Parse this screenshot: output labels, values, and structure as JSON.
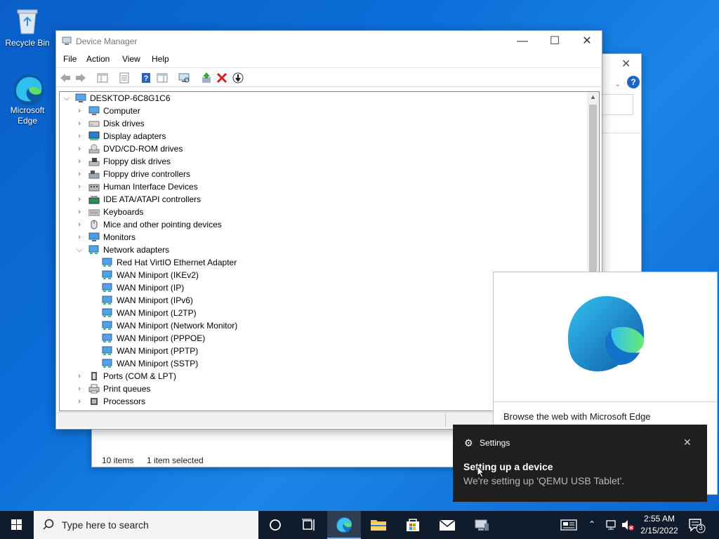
{
  "desktop": {
    "icons": [
      {
        "label": "Recycle Bin"
      },
      {
        "label": "Microsoft Edge"
      }
    ]
  },
  "background_window": {
    "status_items": "10 items",
    "status_selected": "1 item selected"
  },
  "device_manager": {
    "title": "Device Manager",
    "menu": [
      "File",
      "Action",
      "View",
      "Help"
    ],
    "root": "DESKTOP-6C8G1C6",
    "categories": [
      {
        "label": "Computer",
        "icon": "computer-icon"
      },
      {
        "label": "Disk drives",
        "icon": "disk-drive-icon"
      },
      {
        "label": "Display adapters",
        "icon": "display-adapter-icon"
      },
      {
        "label": "DVD/CD-ROM drives",
        "icon": "dvd-drive-icon"
      },
      {
        "label": "Floppy disk drives",
        "icon": "floppy-drive-icon"
      },
      {
        "label": "Floppy drive controllers",
        "icon": "floppy-controller-icon"
      },
      {
        "label": "Human Interface Devices",
        "icon": "hid-icon"
      },
      {
        "label": "IDE ATA/ATAPI controllers",
        "icon": "ide-controller-icon"
      },
      {
        "label": "Keyboards",
        "icon": "keyboard-icon"
      },
      {
        "label": "Mice and other pointing devices",
        "icon": "mouse-icon"
      },
      {
        "label": "Monitors",
        "icon": "monitor-icon"
      },
      {
        "label": "Network adapters",
        "icon": "network-adapter-icon",
        "expanded": true
      }
    ],
    "network_children": [
      "Red Hat VirtIO Ethernet Adapter",
      "WAN Miniport (IKEv2)",
      "WAN Miniport (IP)",
      "WAN Miniport (IPv6)",
      "WAN Miniport (L2TP)",
      "WAN Miniport (Network Monitor)",
      "WAN Miniport (PPPOE)",
      "WAN Miniport (PPTP)",
      "WAN Miniport (SSTP)"
    ],
    "more_categories": [
      {
        "label": "Ports (COM & LPT)",
        "icon": "port-icon"
      },
      {
        "label": "Print queues",
        "icon": "printer-icon"
      },
      {
        "label": "Processors",
        "icon": "processor-icon"
      }
    ]
  },
  "edge_promo": {
    "text": "Browse the web with Microsoft Edge"
  },
  "toast": {
    "app": "Settings",
    "headline": "Setting up a device",
    "body": "We're setting up 'QEMU USB Tablet'."
  },
  "taskbar": {
    "search_placeholder": "Type here to search",
    "time": "2:55 AM",
    "date": "2/15/2022",
    "notification_count": "3"
  },
  "colors": {
    "desktop_blue": "#0b6fd9",
    "taskbar": "#101b2b",
    "toast_bg": "#1f1f1f"
  }
}
